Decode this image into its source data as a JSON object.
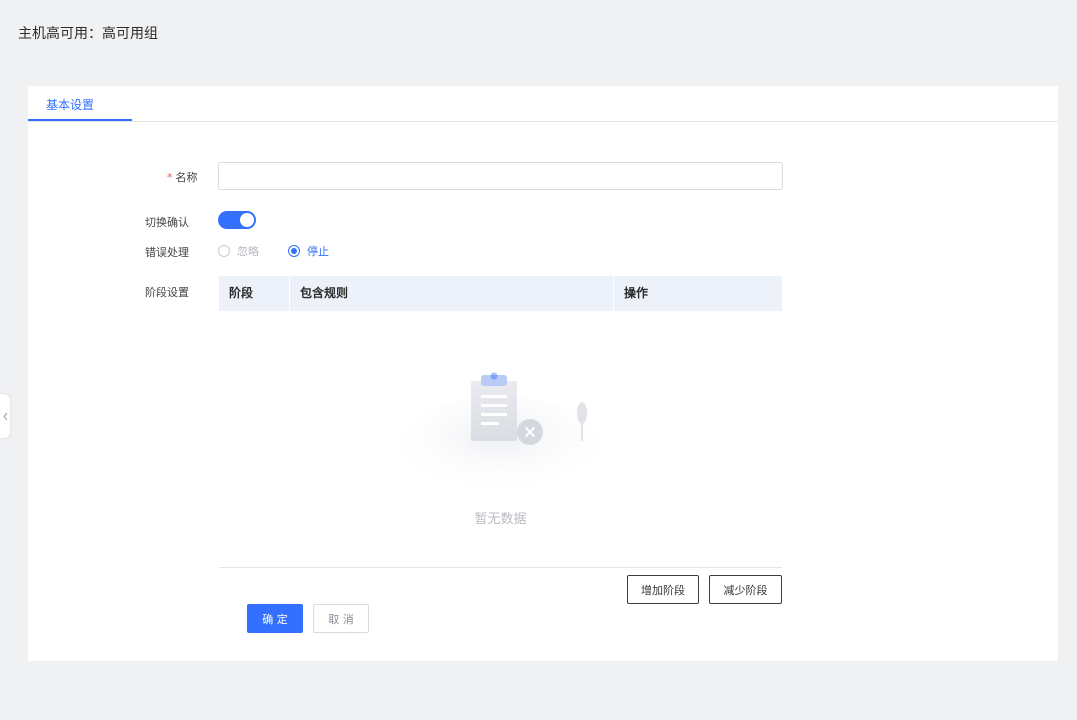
{
  "page": {
    "title": "主机高可用：高可用组"
  },
  "tabs": [
    {
      "label": "基本设置",
      "active": true
    }
  ],
  "form": {
    "name": {
      "label": "名称",
      "required_mark": "*",
      "value": "",
      "placeholder": ""
    },
    "switch_confirm": {
      "label": "切换确认",
      "checked": true
    },
    "error_handling": {
      "label": "错误处理",
      "options": [
        {
          "label": "忽略",
          "checked": false
        },
        {
          "label": "停止",
          "checked": true
        }
      ]
    },
    "stage_settings": {
      "label": "阶段设置"
    }
  },
  "stage_table": {
    "columns": [
      "阶段",
      "包含规则",
      "操作"
    ],
    "rows": [],
    "empty_text": "暂无数据"
  },
  "actions": {
    "add_stage": "增加阶段",
    "remove_stage": "减少阶段",
    "confirm": "确 定",
    "cancel": "取 消"
  },
  "colors": {
    "primary": "#3370ff",
    "required": "#f5503d",
    "table_header_bg": "#edf1fa",
    "page_bg": "#f0f1f3"
  },
  "icons": {
    "collapse_handle": "chevron-left-icon",
    "empty_state": "empty-clipboard-icon"
  }
}
